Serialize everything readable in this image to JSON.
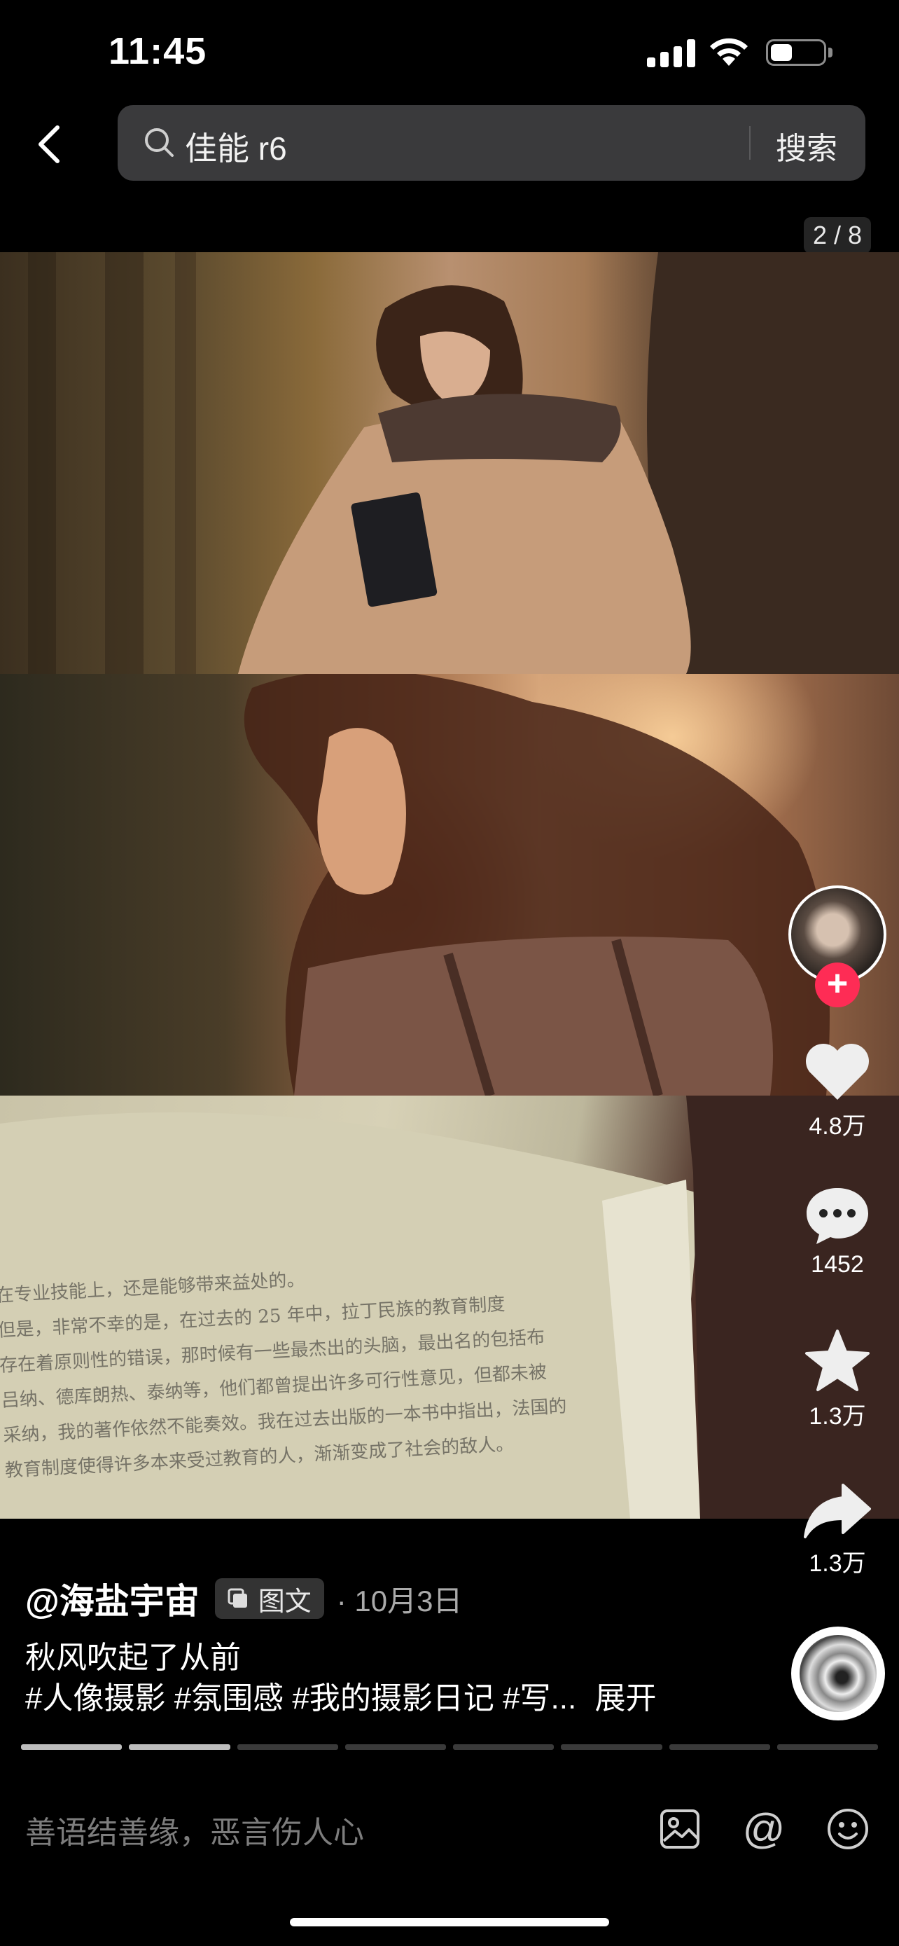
{
  "status_bar": {
    "time": "11:45"
  },
  "header": {
    "search_query": "佳能 r6",
    "search_button": "搜索"
  },
  "gallery": {
    "page_counter": "2 / 8",
    "current_page": 2,
    "total_pages": 8
  },
  "book_text": [
    "在专业技能上，还是能够带来益处的。",
    "但是，非常不幸的是，在过去的 25 年中，拉丁民族的教育制度",
    "存在着原则性的错误，那时候有一些最杰出的头脑，最出名的包括布",
    "吕纳、德库朗热、泰纳等，他们都曾提出许多可行性意见，但都未被",
    "采纳，我的著作依然不能奏效。我在过去出版的一本书中指出，法国的",
    "教育制度使得许多本来受过教育的人，渐渐变成了社会的敌人。"
  ],
  "actions": {
    "like_count": "4.8万",
    "comment_count": "1452",
    "favorite_count": "1.3万",
    "share_count": "1.3万",
    "follow_label": "+"
  },
  "post": {
    "author": "@海盐宇宙",
    "type_badge": "图文",
    "date": "· 10月3日",
    "caption": "秋风吹起了从前",
    "hashtags": "#人像摄影 #氛围感 #我的摄影日记 #写...",
    "expand_label": "展开"
  },
  "progress": {
    "segments": 8,
    "current": 2
  },
  "comment_bar": {
    "placeholder": "善语结善缘，恶言伤人心",
    "at_symbol": "@"
  },
  "colors": {
    "accent": "#fe2c55",
    "background": "#000000",
    "search_bg": "#3a3a3c"
  }
}
